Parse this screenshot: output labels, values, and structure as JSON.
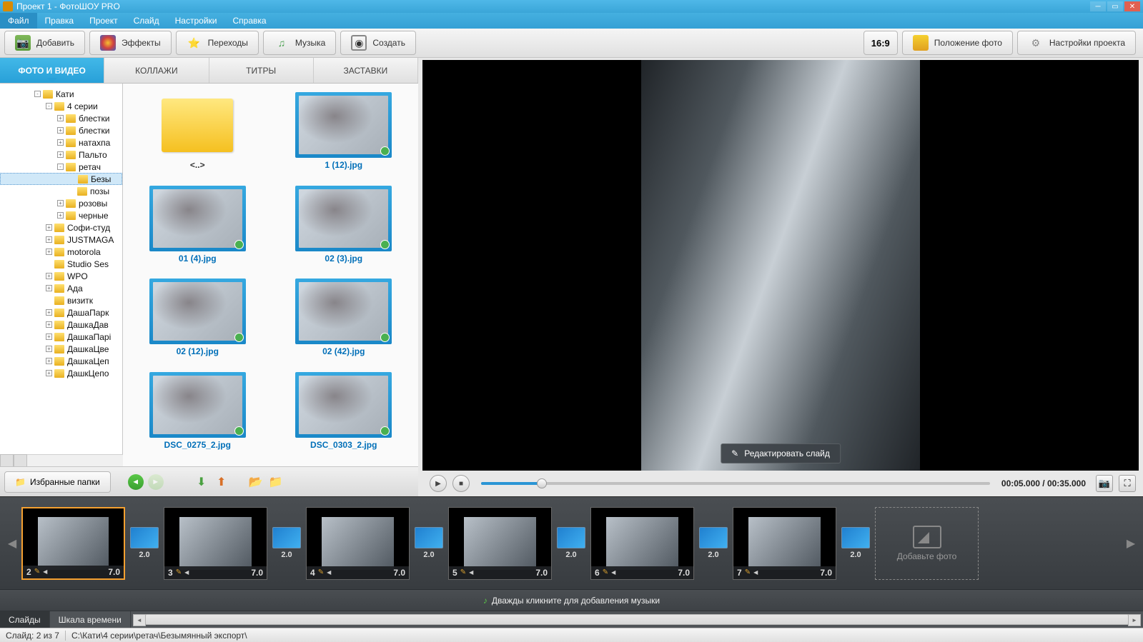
{
  "title": "Проект 1 - ФотоШОУ PRO",
  "menu": [
    "Файл",
    "Правка",
    "Проект",
    "Слайд",
    "Настройки",
    "Справка"
  ],
  "toolbar": {
    "add": "Добавить",
    "fx": "Эффекты",
    "transitions": "Переходы",
    "music": "Музыка",
    "create": "Создать",
    "aspect": "16:9",
    "position": "Положение фото",
    "settings": "Настройки проекта"
  },
  "tabs": {
    "photo": "ФОТО И ВИДЕО",
    "collage": "КОЛЛАЖИ",
    "titles": "ТИТРЫ",
    "intros": "ЗАСТАВКИ"
  },
  "tree": [
    {
      "indent": 0,
      "box": "-",
      "label": "Кати"
    },
    {
      "indent": 1,
      "box": "-",
      "label": "4 серии"
    },
    {
      "indent": 2,
      "box": "+",
      "label": "блестки"
    },
    {
      "indent": 2,
      "box": "+",
      "label": "блестки"
    },
    {
      "indent": 2,
      "box": "+",
      "label": "натахпа"
    },
    {
      "indent": 2,
      "box": "+",
      "label": "Пальто"
    },
    {
      "indent": 2,
      "box": "-",
      "label": "ретач"
    },
    {
      "indent": 3,
      "box": "",
      "label": "Безы",
      "sel": true
    },
    {
      "indent": 3,
      "box": "",
      "label": "позы"
    },
    {
      "indent": 2,
      "box": "+",
      "label": "розовы"
    },
    {
      "indent": 2,
      "box": "+",
      "label": "черные"
    },
    {
      "indent": 1,
      "box": "+",
      "label": "Софи-студ"
    },
    {
      "indent": 1,
      "box": "+",
      "label": "JUSTMAGA"
    },
    {
      "indent": 1,
      "box": "+",
      "label": "motorola"
    },
    {
      "indent": 1,
      "box": "",
      "label": "Studio Ses"
    },
    {
      "indent": 1,
      "box": "+",
      "label": "WPO"
    },
    {
      "indent": 1,
      "box": "+",
      "label": "Ада"
    },
    {
      "indent": 1,
      "box": "",
      "label": "визитк"
    },
    {
      "indent": 1,
      "box": "+",
      "label": "ДашаПарк"
    },
    {
      "indent": 1,
      "box": "+",
      "label": "ДашкаДав"
    },
    {
      "indent": 1,
      "box": "+",
      "label": "ДашкаПарі"
    },
    {
      "indent": 1,
      "box": "+",
      "label": "ДашкаЦве"
    },
    {
      "indent": 1,
      "box": "+",
      "label": "ДашкаЦеп"
    },
    {
      "indent": 1,
      "box": "+",
      "label": "ДашкЦепо"
    }
  ],
  "thumbs": [
    {
      "type": "folder",
      "label": "<..>"
    },
    {
      "type": "img",
      "label": "1 (12).jpg"
    },
    {
      "type": "img",
      "label": "01 (4).jpg"
    },
    {
      "type": "img",
      "label": "02 (3).jpg"
    },
    {
      "type": "img",
      "label": "02 (12).jpg"
    },
    {
      "type": "img",
      "label": "02 (42).jpg"
    },
    {
      "type": "img",
      "label": "DSC_0275_2.jpg"
    },
    {
      "type": "img",
      "label": "DSC_0303_2.jpg"
    }
  ],
  "leftbottom": {
    "fav": "Избранные папки"
  },
  "preview": {
    "edit": "Редактировать слайд",
    "time": "00:05.000 / 00:35.000"
  },
  "slides": [
    {
      "n": "2",
      "dur": "7.0",
      "trans": "2.0",
      "sel": true
    },
    {
      "n": "3",
      "dur": "7.0",
      "trans": "2.0"
    },
    {
      "n": "4",
      "dur": "7.0",
      "trans": "2.0"
    },
    {
      "n": "5",
      "dur": "7.0",
      "trans": "2.0"
    },
    {
      "n": "6",
      "dur": "7.0",
      "trans": "2.0"
    },
    {
      "n": "7",
      "dur": "7.0",
      "trans": "2.0"
    }
  ],
  "addslide": "Добавьте фото",
  "musichint": "Дважды кликните для добавления музыки",
  "btabs": {
    "slides": "Слайды",
    "timeline": "Шкала времени"
  },
  "status": {
    "left": "Слайд: 2 из 7",
    "path": "C:\\Кати\\4 серии\\ретач\\Безымянный экспорт\\"
  }
}
